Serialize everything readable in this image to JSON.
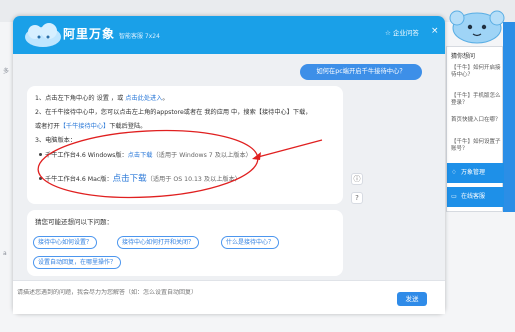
{
  "background": {
    "edge_labels": [
      "多",
      "a"
    ]
  },
  "header": {
    "brand": "阿里万象",
    "subtitle": "智能客服 7x24",
    "right_label": "☆ 企业问答",
    "close_glyph": "×"
  },
  "conversation": {
    "user_message": "如何在pc端开启千牛接待中心？",
    "steps": {
      "s1_prefix": "1、点击左下角中心的 设置 ，或 ",
      "s1_link": "点击此处进入",
      "s1_suffix": "。",
      "s2_prefix": "2、在千牛接待中心中，您可以点击左上角的appstore或者在 ",
      "s2_mid": "我的应用",
      "s2_suffix": " 中，搜索【接待中心】下载，",
      "s3_prefix": "或者打开",
      "s3_link": "【千牛接待中心】",
      "s3_suffix": "下载后登陆。",
      "s4": "3、电脑版本：",
      "win_label": "千牛工作台4.6 Windows版：",
      "win_link": "点击下载",
      "win_suffix": "（适用于 Windows 7 及以上版本）",
      "mac_label": "千牛工作台4.6 Mac版：",
      "mac_link": "点击下载",
      "mac_suffix": "（适用于 OS 10.13 及以上版本）"
    },
    "suggestions": {
      "title": "猜您可能还想问以下问题：",
      "chips": [
        "接待中心如何设置？",
        "接待中心如何打开和关闭？",
        "什么是接待中心？",
        "设置自动回复，在哪里操作？"
      ]
    },
    "side_icons": [
      "ⓘ",
      "?"
    ]
  },
  "input": {
    "placeholder": "请描述您遇到的问题，我会尽力为您解答（如：怎么设置自动回复）",
    "send_label": "发送"
  },
  "right_panel": {
    "title": "猜你想问",
    "items": [
      "【千牛】如何开启接待中心？",
      "【千牛】手机版怎么登录？",
      "首页快捷入口在哪？",
      "【千牛】如何设置子账号？"
    ],
    "btn1": "万象管理",
    "btn2": "在线客服"
  },
  "colors": {
    "header": "#1aa0e8",
    "accent": "#2f8be8",
    "annotation": "#e02020"
  }
}
